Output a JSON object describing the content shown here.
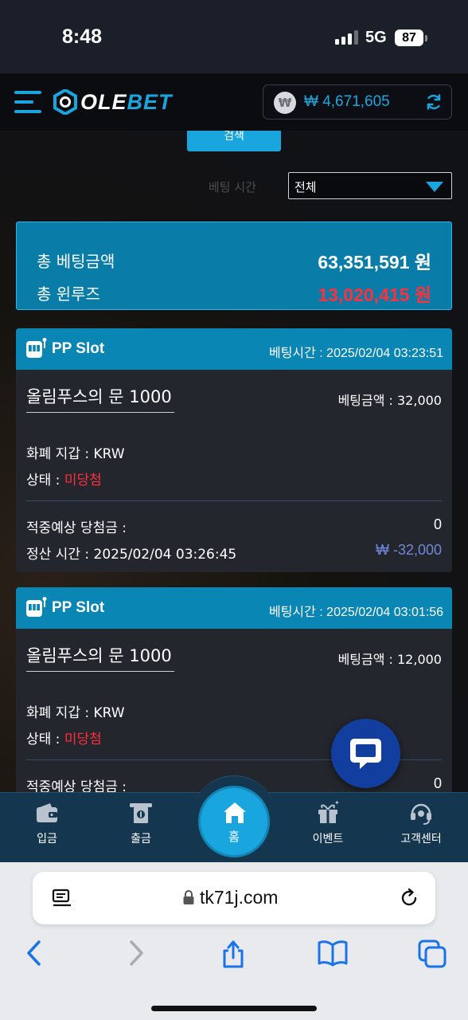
{
  "status_bar": {
    "time": "8:48",
    "network": "5G",
    "battery": "87"
  },
  "header": {
    "logo_prefix": "OLE",
    "logo_suffix": "BET",
    "currency_symbol": "₩",
    "balance": "₩ 4,671,605"
  },
  "filters": {
    "search_label": "검색",
    "period_label": "베팅 시간",
    "select_value": "전체"
  },
  "summary": {
    "total_bet_label": "총 베팅금액",
    "total_bet_value": "63,351,591 원",
    "total_winloss_label": "총 윈루즈",
    "total_winloss_value": "13,020,415 원"
  },
  "bets": [
    {
      "provider": "PP Slot",
      "bet_time": "베팅시간 : 2025/02/04 03:23:51",
      "game": "올림푸스의 문 1000",
      "bet_amount": "베팅금액 : 32,000",
      "currency": "화폐 지갑 : KRW",
      "status_label": "상태 : ",
      "status_value": "미당첨",
      "expected_label": "적중예상 당첨금 :",
      "expected_value": "0",
      "settle_time": "정산 시간 : 2025/02/04 03:26:45",
      "payout": "₩ -32,000"
    },
    {
      "provider": "PP Slot",
      "bet_time": "베팅시간 : 2025/02/04 03:01:56",
      "game": "올림푸스의 문 1000",
      "bet_amount": "베팅금액 : 12,000",
      "currency": "화폐 지갑 : KRW",
      "status_label": "상태 : ",
      "status_value": "미당첨",
      "expected_label": "적중예상 당첨금 :",
      "expected_value": "0"
    }
  ],
  "bottom_nav": {
    "deposit": "입금",
    "withdraw": "출금",
    "home": "홈",
    "event": "이벤트",
    "support": "고객센터"
  },
  "browser": {
    "url": "tk71j.com"
  },
  "colors": {
    "accent": "#19a6de",
    "lose": "#ff2f3c",
    "payout": "#6f89d8",
    "nav_bg": "#14364f"
  }
}
